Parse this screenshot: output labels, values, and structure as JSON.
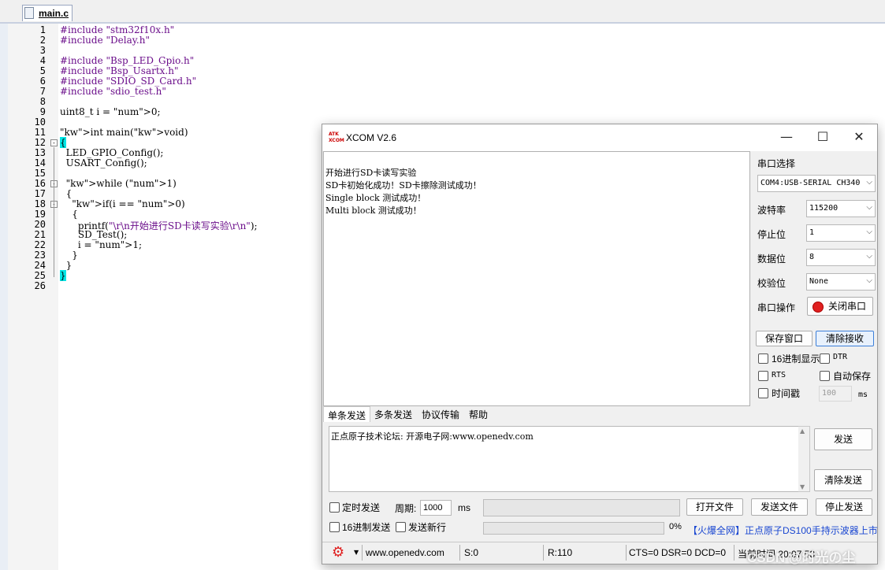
{
  "editor": {
    "tab_label": "main.c",
    "lines": [
      {
        "n": "1",
        "text": "#include \"stm32f10x.h\"",
        "cls": "pp"
      },
      {
        "n": "2",
        "text": "#include \"Delay.h\"",
        "cls": "pp"
      },
      {
        "n": "3",
        "text": "",
        "cls": ""
      },
      {
        "n": "4",
        "text": "#include \"Bsp_LED_Gpio.h\"",
        "cls": "pp"
      },
      {
        "n": "5",
        "text": "#include \"Bsp_Usartx.h\"",
        "cls": "pp"
      },
      {
        "n": "6",
        "text": "#include \"SDIO_SD_Card.h\"",
        "cls": "pp"
      },
      {
        "n": "7",
        "text": "#include \"sdio_test.h\"",
        "cls": "pp"
      },
      {
        "n": "8",
        "text": "",
        "cls": ""
      },
      {
        "n": "9",
        "text": "uint8_t i = 0;",
        "cls": ""
      },
      {
        "n": "10",
        "text": "",
        "cls": ""
      },
      {
        "n": "11",
        "text": "int main(void)",
        "cls": "kw1"
      },
      {
        "n": "12",
        "text": "{",
        "cls": "brace"
      },
      {
        "n": "13",
        "text": "  LED_GPIO_Config();",
        "cls": ""
      },
      {
        "n": "14",
        "text": "  USART_Config();",
        "cls": ""
      },
      {
        "n": "15",
        "text": "",
        "cls": ""
      },
      {
        "n": "16",
        "text": "  while (1)",
        "cls": "while"
      },
      {
        "n": "17",
        "text": "  {",
        "cls": ""
      },
      {
        "n": "18",
        "text": "    if(i == 0)",
        "cls": "if"
      },
      {
        "n": "19",
        "text": "    {",
        "cls": ""
      },
      {
        "n": "20",
        "text": "      printf(\"\\r\\n开始进行SD卡读写实验\\r\\n\");",
        "cls": ""
      },
      {
        "n": "21",
        "text": "      SD_Test();",
        "cls": ""
      },
      {
        "n": "22",
        "text": "      i = 1;",
        "cls": ""
      },
      {
        "n": "23",
        "text": "    }",
        "cls": ""
      },
      {
        "n": "24",
        "text": "  }",
        "cls": ""
      },
      {
        "n": "25",
        "text": "}",
        "cls": "brace"
      },
      {
        "n": "26",
        "text": "",
        "cls": ""
      }
    ]
  },
  "xcom": {
    "title": "XCOM V2.6",
    "logo_text_1": "ATK",
    "logo_text_2": "XCOM",
    "minimize_glyph": "—",
    "maximize_glyph": "☐",
    "close_glyph": "✕",
    "receive_lines": [
      "开始进行SD卡读写实验",
      "SD卡初始化成功！SD卡擦除测试成功！",
      "Single block 测试成功！",
      "Multi block 测试成功！"
    ],
    "port_section_label": "串口选择",
    "port_value": "COM4:USB-SERIAL CH340",
    "baud_label": "波特率",
    "baud_value": "115200",
    "stop_label": "停止位",
    "stop_value": "1",
    "data_label": "数据位",
    "data_value": "8",
    "parity_label": "校验位",
    "parity_value": "None",
    "op_label": "串口操作",
    "close_port_label": "关闭串口",
    "save_window_label": "保存窗口",
    "clear_recv_label": "清除接收",
    "hex_display_label": "16进制显示",
    "dtr_label": "DTR",
    "rts_label": "RTS",
    "autosave_label": "自动保存",
    "timestamp_label": "时间戳",
    "timestamp_value": "100",
    "timestamp_unit": "ms",
    "tabs": [
      "单条发送",
      "多条发送",
      "协议传输",
      "帮助"
    ],
    "send_text": "正点原子技术论坛: 开源电子网:www.openedv.com",
    "send_label": "发送",
    "clear_send_label": "清除发送",
    "timed_send_label": "定时发送",
    "period_label": "周期:",
    "period_value": "1000",
    "period_unit": "ms",
    "open_file_label": "打开文件",
    "send_file_label": "发送文件",
    "stop_send_label": "停止发送",
    "hex_send_label": "16进制发送",
    "send_newline_label": "发送新行",
    "progress_percent_text": "0%",
    "progress": 0,
    "ad_text": "【火爆全网】正点原子DS100手持示波器上市",
    "status": {
      "url": "www.openedv.com",
      "sent": "S:0",
      "received": "R:110",
      "signals": "CTS=0 DSR=0 DCD=0",
      "time": "当前时间 20:07:53"
    },
    "watermark": "CSDN @时光の尘",
    "colors": {
      "accent": "#1a47d1",
      "close_red": "#e02020",
      "ad_red": "#d00000"
    }
  }
}
